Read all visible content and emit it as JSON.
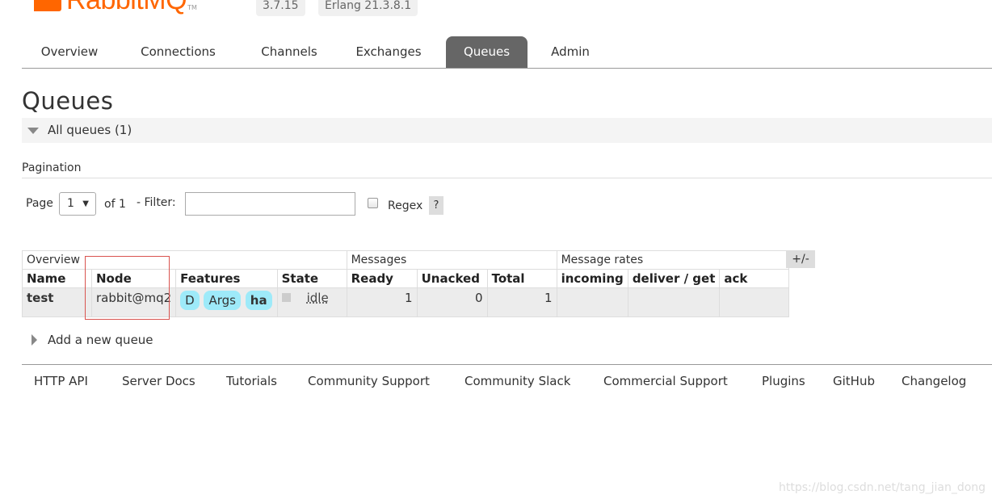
{
  "header": {
    "logo_text": "RabbitMQ",
    "logo_tm": "TM",
    "version": "3.7.15",
    "erlang": "Erlang 21.3.8.1"
  },
  "tabs": [
    {
      "label": "Overview"
    },
    {
      "label": "Connections"
    },
    {
      "label": "Channels"
    },
    {
      "label": "Exchanges"
    },
    {
      "label": "Queues",
      "active": true
    },
    {
      "label": "Admin"
    }
  ],
  "page": {
    "title": "Queues",
    "section_title": "All queues (1)"
  },
  "pagination": {
    "label": "Pagination",
    "page_label": "Page",
    "page_value": "1",
    "of_label": "of 1",
    "filter_label": "- Filter:",
    "filter_value": "",
    "regex_label": "Regex",
    "help": "?"
  },
  "table": {
    "groups": {
      "overview": "Overview",
      "messages": "Messages",
      "rates": "Message rates"
    },
    "headers": {
      "name": "Name",
      "node": "Node",
      "features": "Features",
      "state": "State",
      "ready": "Ready",
      "unacked": "Unacked",
      "total": "Total",
      "incoming": "incoming",
      "deliver": "deliver / get",
      "ack": "ack"
    },
    "rows": [
      {
        "name": "test",
        "node": "rabbit@mq2",
        "features": [
          "D",
          "Args",
          "ha"
        ],
        "state": "idle",
        "ready": "1",
        "unacked": "0",
        "total": "1",
        "incoming": "",
        "deliver": "",
        "ack": ""
      }
    ],
    "toggle": "+/-"
  },
  "add_queue": "Add a new queue",
  "footer": [
    "HTTP API",
    "Server Docs",
    "Tutorials",
    "Community Support",
    "Community Slack",
    "Commercial Support",
    "Plugins",
    "GitHub",
    "Changelog"
  ],
  "watermark": "https://blog.csdn.net/tang_jian_dong",
  "colors": {
    "brand": "#ff6600",
    "active_tab": "#666666",
    "tag": "#9eeaf9",
    "highlight": "#d9534f"
  }
}
